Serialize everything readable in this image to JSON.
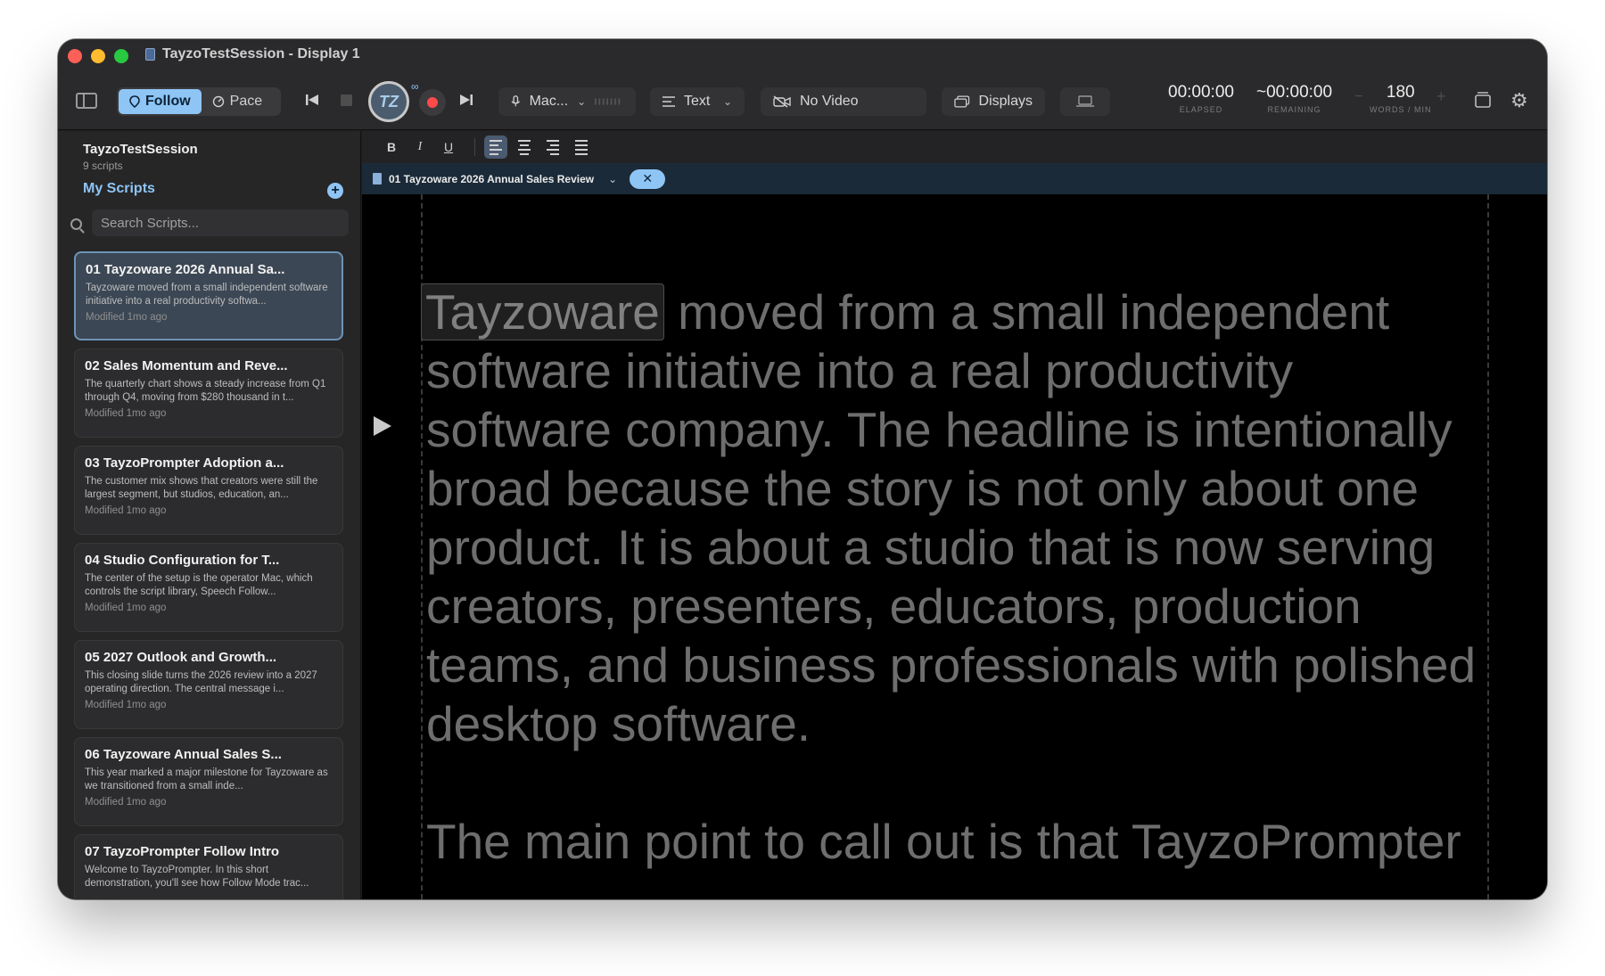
{
  "window": {
    "title": "TayzoTestSession - Display 1"
  },
  "toolbar": {
    "modes": [
      {
        "label": "Follow",
        "icon": "follow-icon",
        "active": true
      },
      {
        "label": "Pace",
        "icon": "pace-icon",
        "active": false
      }
    ],
    "mic_label": "Mac...",
    "view_label": "Text",
    "video_label": "No Video",
    "displays_label": "Displays",
    "elapsed": {
      "value": "00:00:00",
      "label": "ELAPSED"
    },
    "remaining": {
      "value": "~00:00:00",
      "label": "REMAINING"
    },
    "speed": {
      "value": "180",
      "label": "WORDS / MIN",
      "minus": "−",
      "plus": "+"
    },
    "logo_text": "TZ"
  },
  "sidebar": {
    "session_title": "TayzoTestSession",
    "script_count": "9 scripts",
    "section_title": "My Scripts",
    "add_symbol": "+",
    "search_placeholder": "Search Scripts...",
    "scripts": [
      {
        "title": "01 Tayzoware 2026 Annual Sa...",
        "snippet": "Tayzoware moved from a small independent software initiative into a real productivity softwa...",
        "modified": "Modified 1mo ago",
        "active": true
      },
      {
        "title": "02 Sales Momentum and Reve...",
        "snippet": "The quarterly chart shows a steady increase from Q1 through Q4, moving from $280 thousand in t...",
        "modified": "Modified 1mo ago"
      },
      {
        "title": "03 TayzoPrompter Adoption a...",
        "snippet": "The customer mix shows that creators were still the largest segment, but studios, education, an...",
        "modified": "Modified 1mo ago"
      },
      {
        "title": "04 Studio Configuration for T...",
        "snippet": "The center of the setup is the operator Mac, which controls the script library, Speech Follow...",
        "modified": "Modified 1mo ago"
      },
      {
        "title": "05 2027 Outlook and Growth...",
        "snippet": "This closing slide turns the 2026 review into a 2027 operating direction. The central message i...",
        "modified": "Modified 1mo ago"
      },
      {
        "title": "06 Tayzoware Annual Sales S...",
        "snippet": "This year marked a major milestone for Tayzoware as we transitioned from a small inde...",
        "modified": "Modified 1mo ago"
      },
      {
        "title": "07 TayzoPrompter Follow Intro",
        "snippet": "Welcome to TayzoPrompter. In this short demonstration, you'll see how Follow Mode trac...",
        "modified": ""
      }
    ]
  },
  "editor": {
    "format_buttons": {
      "bold": "B",
      "italic": "I",
      "underline": "U"
    },
    "tab_title": "01 Tayzoware 2026 Annual Sales Review",
    "tab_close": "✕",
    "current_word": "Tayzoware",
    "paragraph_1_rest": " moved from a small independent software initiative into a real productivity software company. The headline is intentionally broad because the story is not only about one product. It is about a studio that is now serving creators, presenters, educators, production teams, and business professionals with polished desktop software.",
    "paragraph_2": "The main point to call out is that TayzoPrompter"
  },
  "colors": {
    "accent": "#8ec5f5",
    "record": "#ff4a4a",
    "text_dim": "#6e6e6e",
    "window_bg": "#1e1e1f"
  }
}
